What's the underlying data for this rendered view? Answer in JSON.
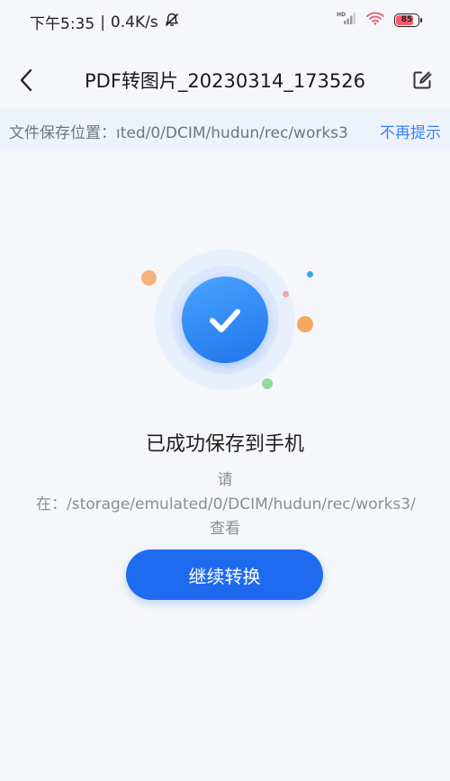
{
  "status_bar": {
    "time": "下午5:35",
    "separator": "|",
    "network_speed": "0.4K/s",
    "battery_level": "85",
    "battery_percent": 85,
    "hd_label": "HD"
  },
  "header": {
    "title": "PDF转图片_20230314_173526"
  },
  "path_banner": {
    "label": "文件保存位置：",
    "path": "ıted/0/DCIM/hudun/rec/works3",
    "dismiss_label": "不再提示"
  },
  "result": {
    "title": "已成功保存到手机",
    "path_prefix": "请在：",
    "path_value": "/storage/emulated/0/DCIM/hudun/rec/works3/",
    "view_link": "查看"
  },
  "actions": {
    "continue_label": "继续转换"
  },
  "colors": {
    "accent": "#1f6bf0",
    "link": "#3b82f6",
    "banner_bg": "#eef3fb",
    "dot_orange": "#f5b27a",
    "dot_blue": "#3aa6e8",
    "dot_pink": "#f3a3b0",
    "dot_green": "#8fdb9c"
  },
  "icons": {
    "back": "chevron-left-icon",
    "edit": "edit-icon",
    "success": "check-circle-icon",
    "mute": "bell-off-icon",
    "signal": "signal-icon",
    "wifi": "wifi-icon",
    "battery": "battery-icon"
  }
}
